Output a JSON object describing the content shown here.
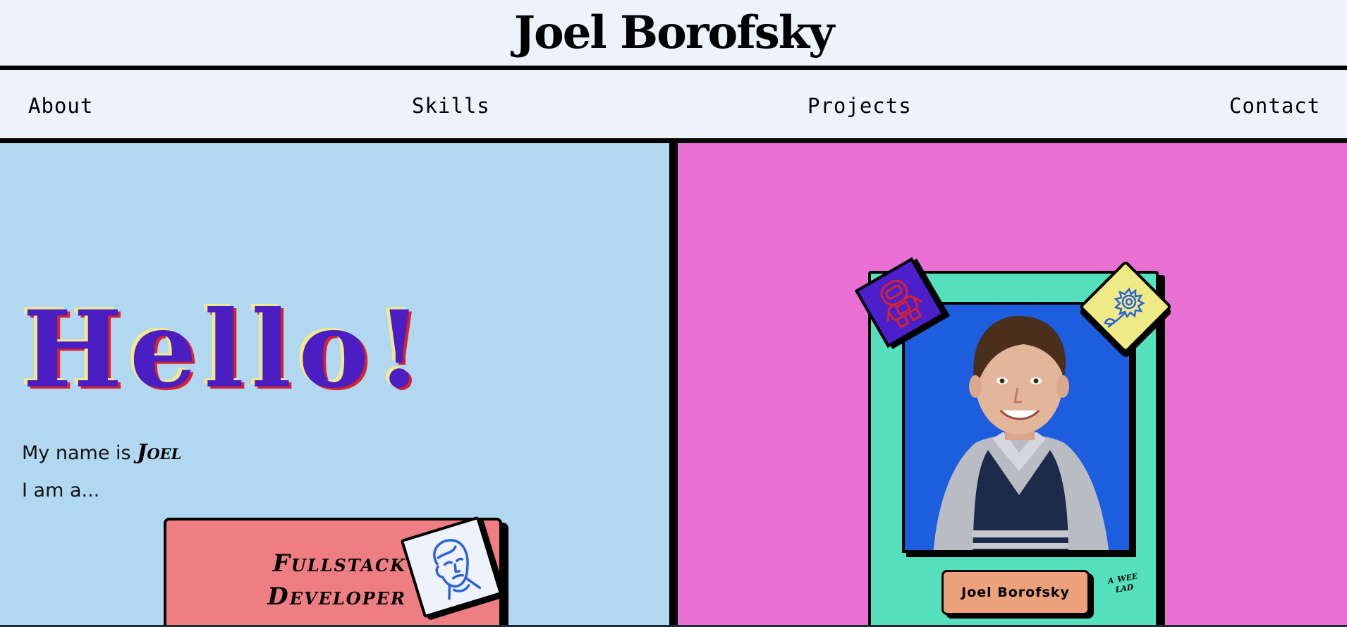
{
  "header": {
    "title": "Joel Borofsky"
  },
  "nav": {
    "items": [
      {
        "label": "About"
      },
      {
        "label": "Skills"
      },
      {
        "label": "Projects"
      },
      {
        "label": "Contact"
      }
    ]
  },
  "hero": {
    "greeting": "Hello!",
    "name_prefix": "My name is",
    "name": "Joel",
    "i_am": "I am a...",
    "role_line1": "Fullstack",
    "role_line2": "Developer",
    "role_icon": "face-outline-icon"
  },
  "card": {
    "nameplate": "Joel Borofsky",
    "caption": "a wee lad",
    "photo": "child-portrait-photo",
    "top_left_icon": "astronaut-icon",
    "top_right_icon": "sunflower-icon"
  },
  "colors": {
    "header_bg": "#eef3fb",
    "left_panel": "#b2d7f0",
    "right_panel": "#ea6fd3",
    "hello_text": "#4a1ec2",
    "hello_shadow_yellow": "#f1e98e",
    "hello_shadow_red": "#d8232e",
    "role_card": "#ef7e82",
    "trading_card": "#55e0bd",
    "photo_bg": "#1d5ede",
    "nameplate": "#eda17b"
  }
}
